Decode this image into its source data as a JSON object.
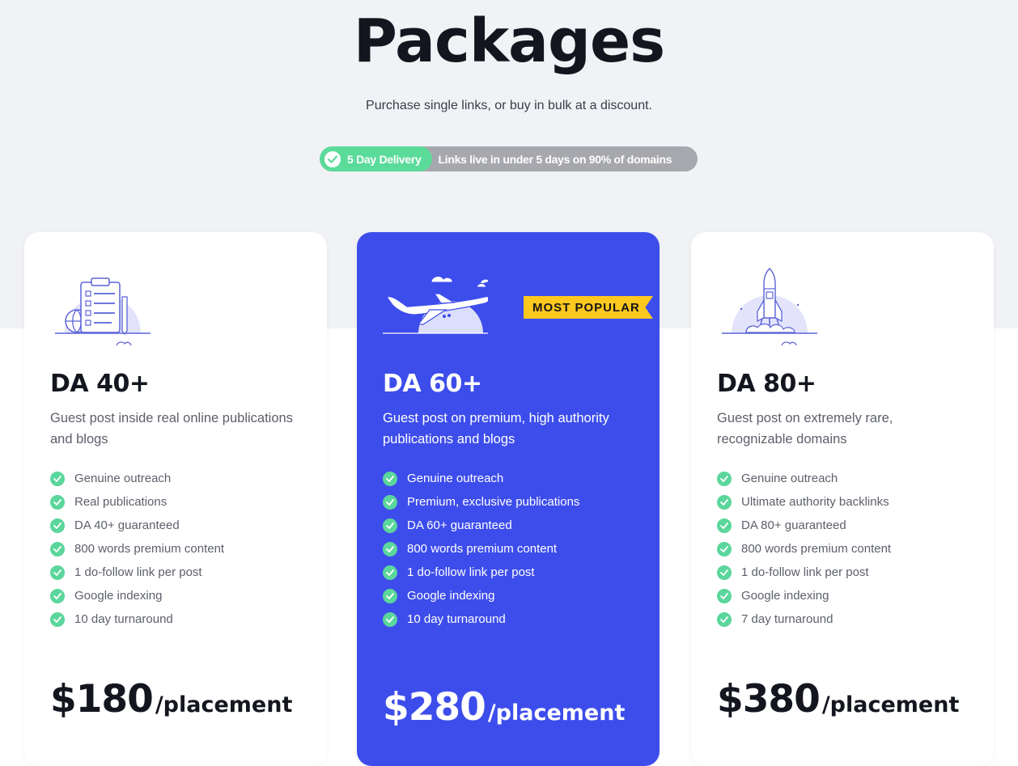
{
  "header": {
    "title": "Packages",
    "subtitle": "Purchase single links, or buy in bulk at a discount.",
    "delivery_badge": "5 Day Delivery",
    "delivery_text": "Links live in under 5 days on 90% of domains"
  },
  "colors": {
    "accent": "#3d4deb",
    "check_green": "#5bd69c",
    "badge_yellow": "#ffc81e",
    "illustration": "#5a63d8"
  },
  "packages": [
    {
      "title": "DA 40+",
      "description": "Guest post inside real online publications and blogs",
      "illustration": "clipboard-checklist-icon",
      "features": [
        "Genuine outreach",
        "Real publications",
        "DA 40+ guaranteed",
        "800 words premium content",
        "1 do-follow link per post",
        "Google indexing",
        "10 day turnaround"
      ],
      "price": "$180",
      "unit": "/placement"
    },
    {
      "title": "DA 60+",
      "description": "Guest post on premium, high authority publications and blogs",
      "illustration": "airplane-icon",
      "badge": "MOST POPULAR",
      "features": [
        "Genuine outreach",
        "Premium, exclusive publications",
        "DA 60+ guaranteed",
        "800 words premium content",
        "1 do-follow link per post",
        "Google indexing",
        "10 day turnaround"
      ],
      "price": "$280",
      "unit": "/placement"
    },
    {
      "title": "DA 80+",
      "description": "Guest post on extremely rare, recognizable domains",
      "illustration": "rocket-launch-icon",
      "features": [
        "Genuine outreach",
        "Ultimate authority backlinks",
        "DA 80+ guaranteed",
        "800 words premium content",
        "1 do-follow link per post",
        "Google indexing",
        "7 day turnaround"
      ],
      "price": "$380",
      "unit": "/placement"
    }
  ]
}
